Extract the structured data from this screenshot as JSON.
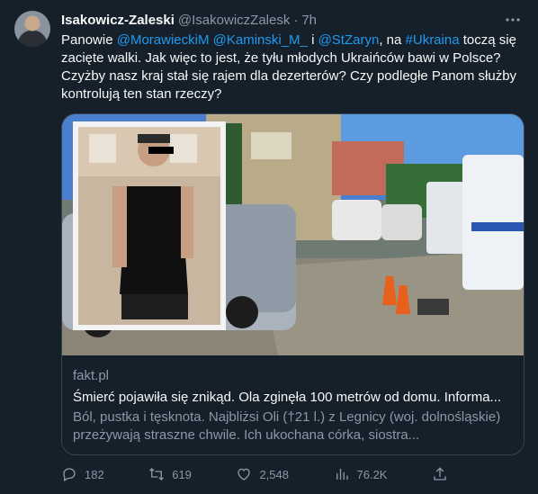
{
  "tweet": {
    "author": {
      "display_name": "Isakowicz-Zaleski",
      "handle": "@IsakowiczZalesk",
      "time": "7h"
    },
    "separator": "·",
    "text": {
      "p1": "Panowie ",
      "m1": "@MorawieckiM",
      "p2": " ",
      "m2": "@Kaminski_M_",
      "p3": " i ",
      "m3": "@StZaryn",
      "p4": ", na ",
      "m4": "#Ukraina",
      "p5": " toczą się zacięte walki. Jak więc to jest, że tyłu młodych Ukraińców bawi w Polsce? Czyżby nasz kraj stał się rajem dla dezerterów? Czy podległe Panom służby kontrolują ten stan rzeczy?"
    },
    "link_card": {
      "domain": "fakt.pl",
      "title": "Śmierć pojawiła się znikąd. Ola zginęła 100 metrów od domu. Informa...",
      "description": "Ból, pustka i tęsknota. Najbliżsi Oli (†21 l.) z Legnicy (woj. dolnośląskie) przeżywają straszne chwile. Ich ukochana córka, siostra..."
    },
    "actions": {
      "replies": "182",
      "retweets": "619",
      "likes": "2,548",
      "views": "76.2K"
    }
  },
  "icons": [
    "more-icon",
    "reply-icon",
    "retweet-icon",
    "like-icon",
    "views-icon",
    "share-icon"
  ],
  "colors": {
    "background": "#15202b",
    "text": "#f7f9f9",
    "secondary": "#8b98a5",
    "link": "#1d9bf0",
    "border": "#38444d"
  }
}
